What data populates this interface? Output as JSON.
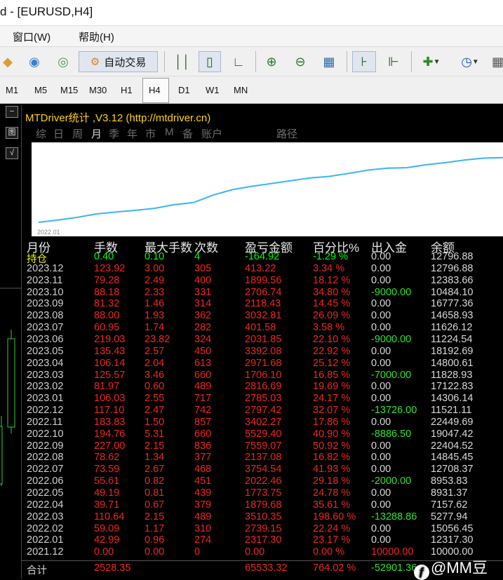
{
  "window": {
    "title": "d - [EURUSD,H4]"
  },
  "menu": [
    {
      "label": "窗口(W)"
    },
    {
      "label": "帮助(H)"
    }
  ],
  "toolbar": {
    "auto_trade_label": "自动交易"
  },
  "timeframes": [
    "M1",
    "M5",
    "M15",
    "M30",
    "H1",
    "H4",
    "D1",
    "W1",
    "MN"
  ],
  "selected_timeframe": "H4",
  "left_strip": [
    "−",
    "图",
    "√"
  ],
  "panel": {
    "title": "MTDriver统计 ,V3.12 (http://mtdriver.cn)",
    "tabs": [
      "综",
      "日",
      "周",
      "月",
      "季",
      "年",
      "市",
      "M",
      "备",
      "账户",
      "路径"
    ],
    "active_tab": "月",
    "chart_xlabel": "2022.01"
  },
  "chart_data": {
    "type": "line",
    "x": [
      "2022.01",
      "2022.02",
      "2022.03",
      "2022.04",
      "2022.05",
      "2022.06",
      "2022.07",
      "2022.08",
      "2022.09",
      "2022.10",
      "2022.11",
      "2022.12",
      "2023.01",
      "2023.02",
      "2023.03",
      "2023.04",
      "2023.05",
      "2023.06",
      "2023.07",
      "2023.08",
      "2023.09",
      "2023.10",
      "2023.11",
      "2023.12"
    ],
    "values": [
      2317.3,
      5056.45,
      8566.8,
      10446.48,
      12220.23,
      14242.69,
      17997.23,
      20134.31,
      27693.38,
      33222.78,
      36625.05,
      39422.47,
      42207.5,
      45024.19,
      46730.29,
      49701.97,
      53094.05,
      55125.9,
      55527.48,
      58560.29,
      60678.72,
      63385.46,
      65285.02,
      65698.24
    ],
    "xlabel": "2022.01",
    "grid": false,
    "line_color": "#3ab4f2"
  },
  "table": {
    "headers": [
      "月份",
      "手数",
      "最大手数",
      "次数",
      "盈亏金额",
      "百分比%",
      "出入金",
      "余额"
    ],
    "open": [
      "持仓",
      "0.40",
      "0.10",
      "4",
      "-164.92",
      "-1.29 %",
      "0.00",
      "12796.88"
    ],
    "rows": [
      [
        "2023.12",
        "123.92",
        "3.00",
        "305",
        "413.22",
        "3.34 %",
        "0.00",
        "12796.88"
      ],
      [
        "2023.11",
        "79.28",
        "2.49",
        "400",
        "1899.56",
        "18.12 %",
        "0.00",
        "12383.66"
      ],
      [
        "2023.10",
        "88.18",
        "2.33",
        "331",
        "2706.74",
        "34.80 %",
        "-9000.00",
        "10484.10"
      ],
      [
        "2023.09",
        "81.32",
        "1.46",
        "314",
        "2118.43",
        "14.45 %",
        "0.00",
        "16777.36"
      ],
      [
        "2023.08",
        "88.00",
        "1.93",
        "362",
        "3032.81",
        "26.09 %",
        "0.00",
        "14658.93"
      ],
      [
        "2023.07",
        "60.95",
        "1.74",
        "282",
        "401.58",
        "3.58 %",
        "0.00",
        "11626.12"
      ],
      [
        "2023.06",
        "219.03",
        "23.82",
        "324",
        "2031.85",
        "22.10 %",
        "-9000.00",
        "11224.54"
      ],
      [
        "2023.05",
        "135.43",
        "2.57",
        "450",
        "3392.08",
        "22.92 %",
        "0.00",
        "18192.69"
      ],
      [
        "2023.04",
        "106.14",
        "2.04",
        "613",
        "2971.68",
        "25.12 %",
        "0.00",
        "14800.61"
      ],
      [
        "2023.03",
        "125.57",
        "3.46",
        "660",
        "1706.10",
        "16.85 %",
        "-7000.00",
        "11828.93"
      ],
      [
        "2023.02",
        "81.97",
        "0.60",
        "489",
        "2816.69",
        "19.69 %",
        "0.00",
        "17122.83"
      ],
      [
        "2023.01",
        "106.03",
        "2.55",
        "717",
        "2785.03",
        "24.17 %",
        "0.00",
        "14306.14"
      ],
      [
        "2022.12",
        "117.10",
        "2.47",
        "742",
        "2797.42",
        "32.07 %",
        "-13726.00",
        "11521.11"
      ],
      [
        "2022.11",
        "183.83",
        "1.50",
        "857",
        "3402.27",
        "17.86 %",
        "0.00",
        "22449.69"
      ],
      [
        "2022.10",
        "194.76",
        "5.31",
        "660",
        "5529.40",
        "40.90 %",
        "-8886.50",
        "19047.42"
      ],
      [
        "2022.09",
        "227.00",
        "2.15",
        "836",
        "7559.07",
        "50.92 %",
        "0.00",
        "22404.52"
      ],
      [
        "2022.08",
        "78.62",
        "1.34",
        "377",
        "2137.08",
        "16.82 %",
        "0.00",
        "14845.45"
      ],
      [
        "2022.07",
        "73.59",
        "2.67",
        "468",
        "3754.54",
        "41.93 %",
        "0.00",
        "12708.37"
      ],
      [
        "2022.06",
        "55.61",
        "0.82",
        "451",
        "2022.46",
        "29.18 %",
        "-2000.00",
        "8953.83"
      ],
      [
        "2022.05",
        "49.19",
        "0.81",
        "439",
        "1773.75",
        "24.78 %",
        "0.00",
        "8931.37"
      ],
      [
        "2022.04",
        "39.71",
        "0.67",
        "379",
        "1879.68",
        "35.61 %",
        "0.00",
        "7157.62"
      ],
      [
        "2022.03",
        "110.64",
        "2.15",
        "489",
        "3510.35",
        "198.60 %",
        "-13288.86",
        "5277.94"
      ],
      [
        "2022.02",
        "59.09",
        "1.17",
        "310",
        "2739.15",
        "22.24 %",
        "0.00",
        "15056.45"
      ],
      [
        "2022.01",
        "42.99",
        "0.96",
        "274",
        "2317.30",
        "23.17 %",
        "0.00",
        "12317.30"
      ],
      [
        "2021.12",
        "0.00",
        "0.00",
        "0",
        "0.00",
        "0.00 %",
        "10000.00",
        "10000.00"
      ]
    ],
    "total": [
      "合计",
      "2528.35",
      "",
      "",
      "65533.32",
      "764.02 %",
      "-52901.36",
      ""
    ]
  },
  "watermark": {
    "logo": "ƒ",
    "text": "@MM豆"
  },
  "colors": {
    "profit": "#f02424",
    "loss_or_withdraw": "#2ee32e",
    "open_row": "#f5f500",
    "title": "#ffd400",
    "line": "#3ab4f2"
  }
}
